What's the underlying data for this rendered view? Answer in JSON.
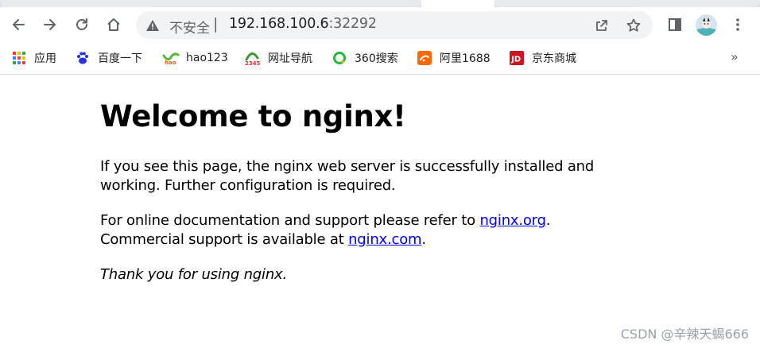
{
  "browser": {
    "address_bar": {
      "security_status": "不安全",
      "separator": "|",
      "host": "192.168.100.6",
      "port": ":32292"
    },
    "bookmarks": [
      {
        "label": "应用",
        "icon": "apps-grid-icon"
      },
      {
        "label": "百度一下",
        "icon": "baidu-paw-icon"
      },
      {
        "label": "hao123",
        "icon": "hao123-icon"
      },
      {
        "label": "网址导航",
        "icon": "2345-icon"
      },
      {
        "label": "360搜索",
        "icon": "360-search-icon"
      },
      {
        "label": "阿里1688",
        "icon": "alibaba-1688-icon"
      },
      {
        "label": "京东商城",
        "icon": "jd-icon"
      }
    ],
    "bookmarks_more": "»"
  },
  "page": {
    "title": "Welcome to nginx!",
    "para1": "If you see this page, the nginx web server is successfully installed and working. Further configuration is required.",
    "para2_prefix": "For online documentation and support please refer to ",
    "link_org": "nginx.org",
    "para2_mid": ". Commercial support is available at ",
    "link_com": "nginx.com",
    "para2_suffix": ".",
    "thanks": "Thank you for using nginx."
  },
  "watermark": "CSDN @辛辣天蝎666",
  "colors": {
    "link": "#0000ee",
    "chrome_icon": "#5f6368",
    "omnibox_bg": "#f1f3f4"
  }
}
